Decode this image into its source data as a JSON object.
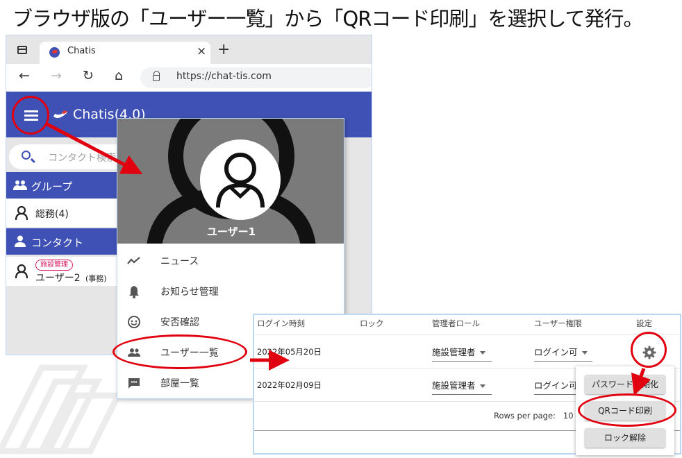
{
  "caption": "ブラウザ版の「ユーザー一覧」から「QRコード印刷」を選択して発行。",
  "browser": {
    "tab_title": "Chatis",
    "url": "https://chat-tis.com",
    "tab_close": "×",
    "new_tab": "+",
    "nav": {
      "back": "←",
      "forward": "→",
      "reload": "↻",
      "home": "⌂"
    }
  },
  "app": {
    "title": "Chatis(4.0)",
    "search_placeholder": "コンタクト検索",
    "group_section": "グループ",
    "group_item": "総務(4)",
    "contact_section": "コンタクト",
    "contact_badge": "施設管理",
    "contact_name": "ユーザー2",
    "contact_dept": "(事務)"
  },
  "drawer": {
    "user_name": "ユーザー1",
    "items": [
      {
        "label": "ニュース",
        "icon": "trending-icon"
      },
      {
        "label": "お知らせ管理",
        "icon": "bell-icon"
      },
      {
        "label": "安否確認",
        "icon": "face-icon"
      },
      {
        "label": "ユーザー一覧",
        "icon": "people-icon"
      },
      {
        "label": "部屋一覧",
        "icon": "chat-icon"
      }
    ]
  },
  "table": {
    "headers": [
      "ログイン時刻",
      "ロック",
      "管理者ロール",
      "ユーザー権限",
      "設定"
    ],
    "rows": [
      {
        "login": "2022年05月20日",
        "role": "施設管理者",
        "perm": "ログイン可"
      },
      {
        "login": "2022年02月09日",
        "role": "施設管理者",
        "perm": "ログイン可"
      }
    ],
    "rows_per_page_label": "Rows per page:",
    "rows_per_page_value": "10"
  },
  "popup": {
    "items": [
      "パスワード初期化",
      "QRコード印刷",
      "ロック解除"
    ]
  },
  "colors": {
    "primary": "#3f51b5",
    "annotation_red": "#e0000f",
    "badge_pink": "#d81b60"
  }
}
